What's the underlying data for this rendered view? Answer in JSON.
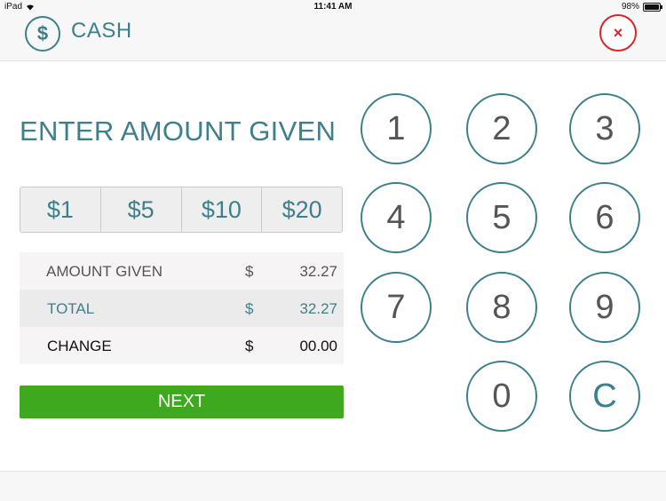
{
  "status_bar": {
    "device": "iPad",
    "time": "11:41 AM",
    "battery_text": "98%",
    "battery_level": 0.98
  },
  "header": {
    "icon": "dollar-circle-icon",
    "icon_glyph": "$",
    "title": "CASH",
    "close_glyph": "×"
  },
  "prompt": "ENTER AMOUNT GIVEN",
  "quick_amounts": [
    "$1",
    "$5",
    "$10",
    "$20"
  ],
  "summary": {
    "amount_given": {
      "label": "AMOUNT GIVEN",
      "currency": "$",
      "value": "32.27"
    },
    "total": {
      "label": "TOTAL",
      "currency": "$",
      "value": "32.27"
    },
    "change": {
      "label": "CHANGE",
      "currency": "$",
      "value": "00.00"
    }
  },
  "next_label": "NEXT",
  "keypad": {
    "k1": "1",
    "k2": "2",
    "k3": "3",
    "k4": "4",
    "k5": "5",
    "k6": "6",
    "k7": "7",
    "k8": "8",
    "k9": "9",
    "k0": "0",
    "clear": "C"
  },
  "colors": {
    "accent": "#3e7f8c",
    "close": "#d9262a",
    "next": "#3ea81f"
  }
}
